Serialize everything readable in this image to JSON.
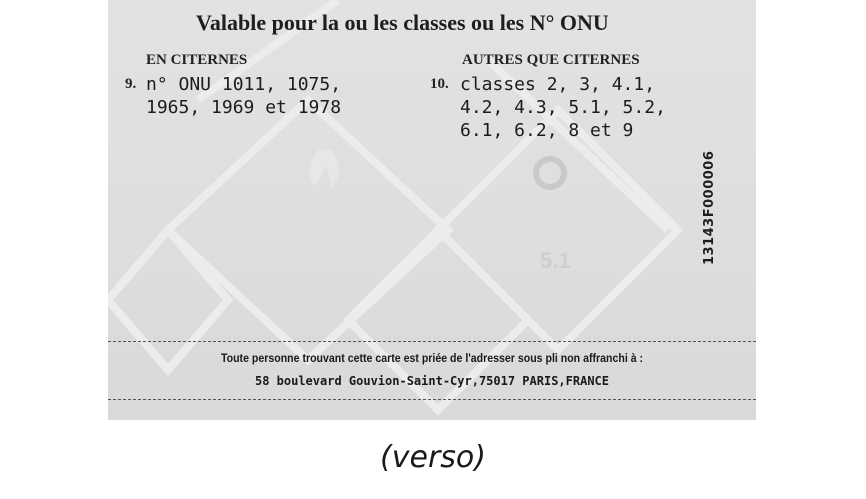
{
  "card": {
    "heading": "Valable pour la ou les classes ou les N° ONU",
    "left_column": {
      "title": "EN CITERNES",
      "number": "9.",
      "lines": [
        "n° ONU 1011, 1075,",
        "1965, 1969 et 1978"
      ]
    },
    "right_column": {
      "title": "AUTRES QUE CITERNES",
      "number": "10.",
      "lines": [
        "classes 2, 3, 4.1,",
        "4.2, 4.3, 5.1, 5.2,",
        "6.1, 6.2, 8 et 9"
      ]
    },
    "serial": "13143F000006",
    "watermark_label": "5.1",
    "notice": "Toute personne trouvant cette carte est priée de l'adresser sous pli non affranchi à :",
    "address": "58 boulevard Gouvion-Saint-Cyr,75017 PARIS,FRANCE"
  },
  "caption": "(verso)",
  "colors": {
    "card_background": "#dedede",
    "text": "#1e1e1e"
  },
  "icons": [
    "flame-icon",
    "oxidizer-icon"
  ]
}
